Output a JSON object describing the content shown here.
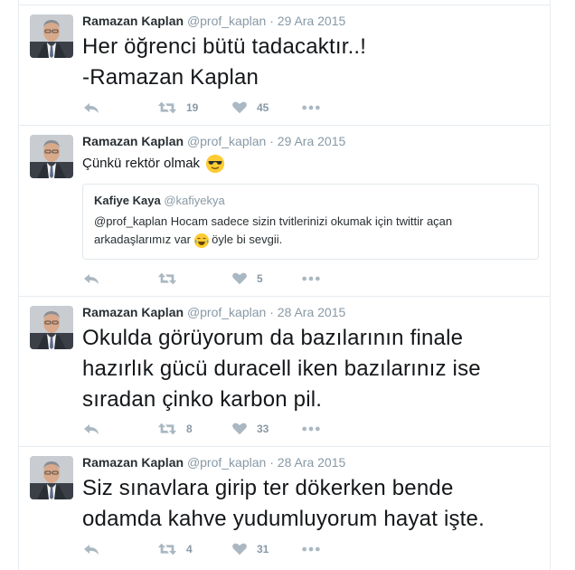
{
  "colors": {
    "accent": "#1da1f2",
    "muted": "#8899a6",
    "border": "#e6ecf0"
  },
  "tweets": [
    {
      "name": "Ramazan Kaplan",
      "handle": "@prof_kaplan",
      "separator": "·",
      "time": "29 Ara 2015",
      "lines": [
        "Her öğrenci bütü tadacaktır..!",
        "-Ramazan Kaplan"
      ],
      "retweets": "19",
      "likes": "45"
    },
    {
      "name": "Ramazan Kaplan",
      "handle": "@prof_kaplan",
      "separator": "·",
      "time": "29 Ara 2015",
      "text": "Çünkü rektör olmak",
      "emoji": "smiling-face-with-sunglasses",
      "quote": {
        "name": "Kafiye Kaya",
        "handle": "@kafiyekya",
        "line1": "@prof_kaplan Hocam sadece sizin tvitlerinizi okumak için twittir açan",
        "line2_before": "arkadaşlarımız var",
        "line2_emoji": "face-with-tears-of-joy",
        "line2_after": "öyle bi sevgii."
      },
      "retweets": "",
      "likes": "5"
    },
    {
      "name": "Ramazan Kaplan",
      "handle": "@prof_kaplan",
      "separator": "·",
      "time": "28 Ara 2015",
      "lines": [
        "Okulda görüyorum da bazılarının finale",
        "hazırlık gücü duracell iken bazılarınız ise",
        "sıradan çinko karbon pil."
      ],
      "retweets": "8",
      "likes": "33"
    },
    {
      "name": "Ramazan Kaplan",
      "handle": "@prof_kaplan",
      "separator": "·",
      "time": "28 Ara 2015",
      "lines": [
        "Siz sınavlara girip ter dökerken bende",
        "odamda kahve yudumluyorum hayat işte."
      ],
      "retweets": "4",
      "likes": "31"
    }
  ]
}
